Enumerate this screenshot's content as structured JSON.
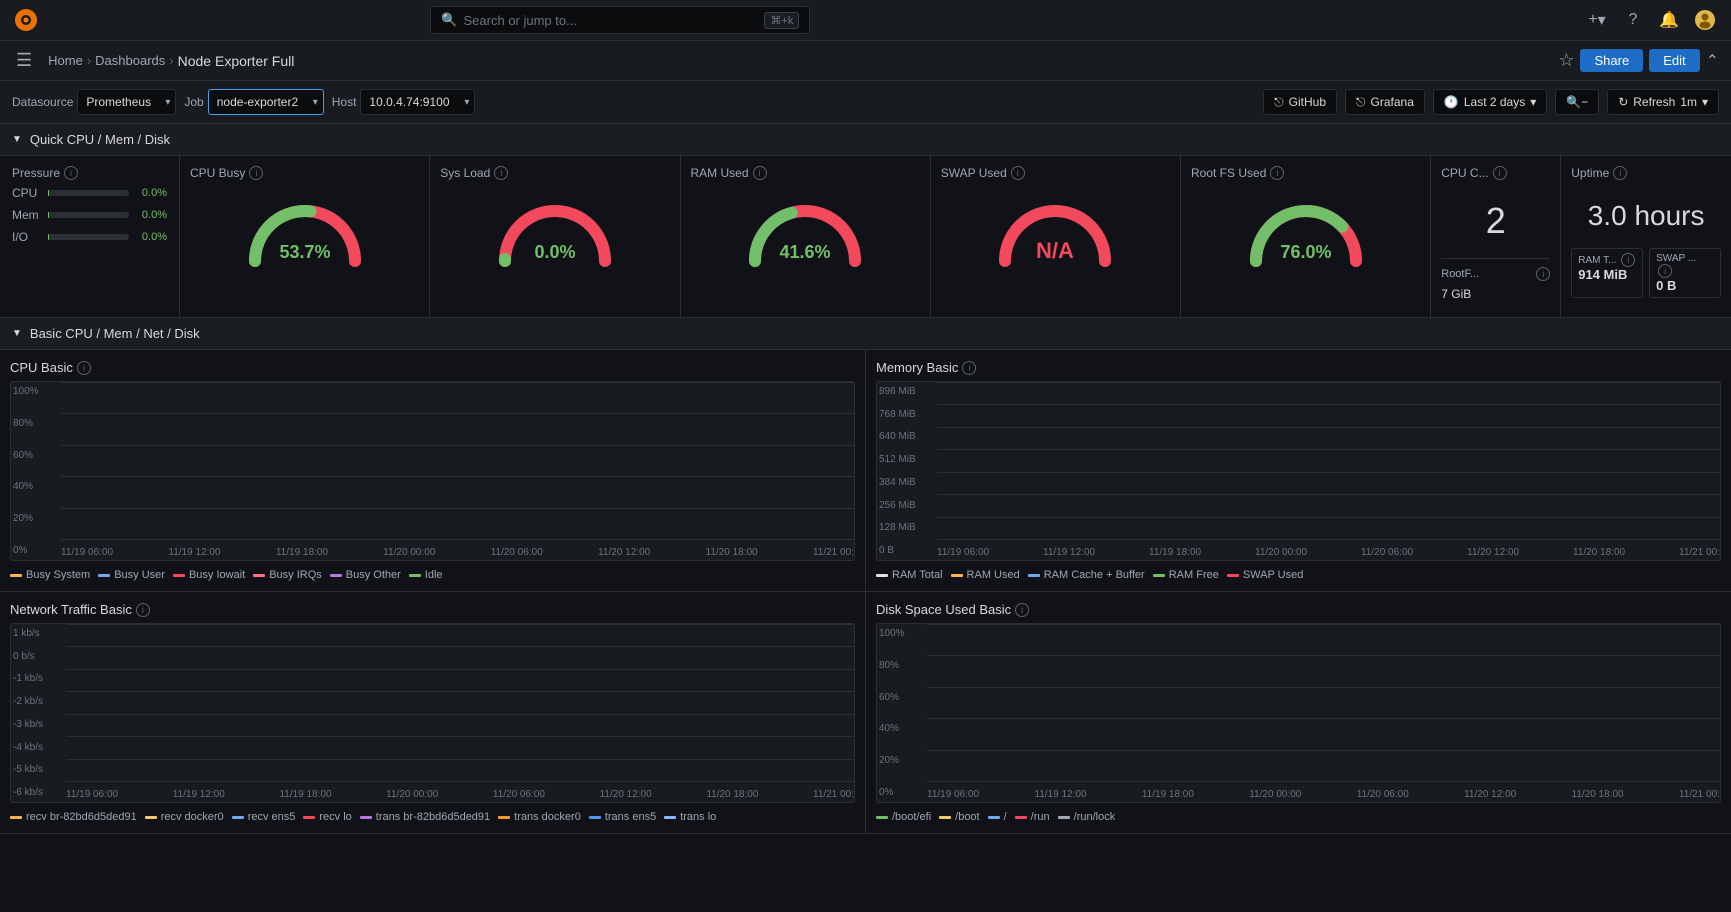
{
  "topbar": {
    "search_placeholder": "Search or jump to...",
    "search_shortcut": "⌘+k",
    "plus_label": "+",
    "help_icon": "?",
    "bell_icon": "🔔",
    "avatar_icon": "👤"
  },
  "navbar": {
    "home": "Home",
    "dashboards": "Dashboards",
    "current": "Node Exporter Full",
    "share_label": "Share",
    "edit_label": "Edit"
  },
  "toolbar": {
    "datasource_label": "Datasource",
    "datasource_value": "Prometheus",
    "job_label": "Job",
    "job_value": "node-exporter2",
    "host_label": "Host",
    "host_value": "10.0.4.74:9100",
    "github_label": "GitHub",
    "grafana_label": "Grafana",
    "time_range": "Last 2 days",
    "refresh_label": "Refresh",
    "refresh_interval": "1m"
  },
  "section_quick": {
    "title": "Quick CPU / Mem / Disk"
  },
  "pressure": {
    "title": "Pressure",
    "cpu_label": "CPU",
    "cpu_value": "0.0%",
    "cpu_pct": 0,
    "mem_label": "Mem",
    "mem_value": "0.0%",
    "mem_pct": 0,
    "io_label": "I/O",
    "io_value": "0.0%",
    "io_pct": 0
  },
  "cpu_busy": {
    "title": "CPU Busy",
    "value": "53.7%",
    "color": "#73bf69",
    "angle": 53.7
  },
  "sys_load": {
    "title": "Sys Load",
    "value": "0.0%",
    "color": "#73bf69",
    "angle": 0
  },
  "ram_used": {
    "title": "RAM Used",
    "value": "41.6%",
    "color": "#73bf69",
    "angle": 41.6
  },
  "swap_used": {
    "title": "SWAP Used",
    "value": "N/A",
    "color": "#f2495c",
    "is_na": true
  },
  "root_fs_used": {
    "title": "Root FS Used",
    "value": "76.0%",
    "color": "#73bf69",
    "angle": 76.0
  },
  "cpu_count": {
    "title": "CPU C...",
    "value": "2",
    "rootfs_label": "RootF...",
    "rootfs_value": "7 GiB",
    "ram_total_label": "RAM T...",
    "ram_total_value": "914 MiB",
    "swap_label": "SWAP ...",
    "swap_value": "0 B"
  },
  "uptime": {
    "title": "Uptime",
    "value": "3.0 hours"
  },
  "section_basic": {
    "title": "Basic CPU / Mem / Net / Disk"
  },
  "cpu_basic": {
    "title": "CPU Basic",
    "yaxis": [
      "100%",
      "80%",
      "60%",
      "40%",
      "20%",
      "0%"
    ],
    "xaxis": [
      "11/19 06:00",
      "11/19 12:00",
      "11/19 18:00",
      "11/20 00:00",
      "11/20 06:00",
      "11/20 12:00",
      "11/20 18:00",
      "11/21 00:"
    ],
    "legend": [
      {
        "label": "Busy System",
        "color": "#ffb357"
      },
      {
        "label": "Busy User",
        "color": "#73a9e8"
      },
      {
        "label": "Busy Iowait",
        "color": "#f2495c"
      },
      {
        "label": "Busy IRQs",
        "color": "#ff7383"
      },
      {
        "label": "Busy Other",
        "color": "#b877d9"
      },
      {
        "label": "Idle",
        "color": "#73bf69"
      }
    ]
  },
  "memory_basic": {
    "title": "Memory Basic",
    "yaxis": [
      "896 MiB",
      "768 MiB",
      "640 MiB",
      "512 MiB",
      "384 MiB",
      "256 MiB",
      "128 MiB",
      "0 B"
    ],
    "xaxis": [
      "11/19 06:00",
      "11/19 12:00",
      "11/19 18:00",
      "11/20 00:00",
      "11/20 06:00",
      "11/20 12:00",
      "11/20 18:00",
      "11/21 00:"
    ],
    "legend": [
      {
        "label": "RAM Total",
        "color": "#e0e0e0"
      },
      {
        "label": "RAM Used",
        "color": "#ffb357"
      },
      {
        "label": "RAM Cache + Buffer",
        "color": "#73a9e8"
      },
      {
        "label": "RAM Free",
        "color": "#73bf69"
      },
      {
        "label": "SWAP Used",
        "color": "#f2495c"
      }
    ]
  },
  "network_basic": {
    "title": "Network Traffic Basic",
    "yaxis": [
      "1 kb/s",
      "0 b/s",
      "-1 kb/s",
      "-2 kb/s",
      "-3 kb/s",
      "-4 kb/s",
      "-5 kb/s",
      "-6 kb/s"
    ],
    "xaxis": [
      "11/19 06:00",
      "11/19 12:00",
      "11/19 18:00",
      "11/20 00:00",
      "11/20 06:00",
      "11/20 12:00",
      "11/20 18:00",
      "11/21 00:"
    ],
    "legend": [
      {
        "label": "recv br-82bd6d5ded91",
        "color": "#ffb357"
      },
      {
        "label": "recv docker0",
        "color": "#f2c96d"
      },
      {
        "label": "recv ens5",
        "color": "#73a9e8"
      },
      {
        "label": "recv lo",
        "color": "#f2495c"
      },
      {
        "label": "trans br-82bd6d5ded91",
        "color": "#b877d9"
      },
      {
        "label": "trans docker0",
        "color": "#ff9830"
      },
      {
        "label": "trans ens5",
        "color": "#5794f2"
      },
      {
        "label": "trans lo",
        "color": "#8ab8ff"
      }
    ]
  },
  "disk_space": {
    "title": "Disk Space Used Basic",
    "yaxis": [
      "100%",
      "80%",
      "60%",
      "40%",
      "20%",
      "0%"
    ],
    "xaxis": [
      "11/19 06:00",
      "11/19 12:00",
      "11/19 18:00",
      "11/20 00:00",
      "11/20 06:00",
      "11/20 12:00",
      "11/20 18:00",
      "11/21 00:"
    ],
    "legend": [
      {
        "label": "/boot/efi",
        "color": "#73bf69"
      },
      {
        "label": "/boot",
        "color": "#f2c96d"
      },
      {
        "label": "/",
        "color": "#73a9e8"
      },
      {
        "label": "/run",
        "color": "#f2495c"
      },
      {
        "label": "/run/lock",
        "color": "#9fa7b3"
      }
    ]
  }
}
